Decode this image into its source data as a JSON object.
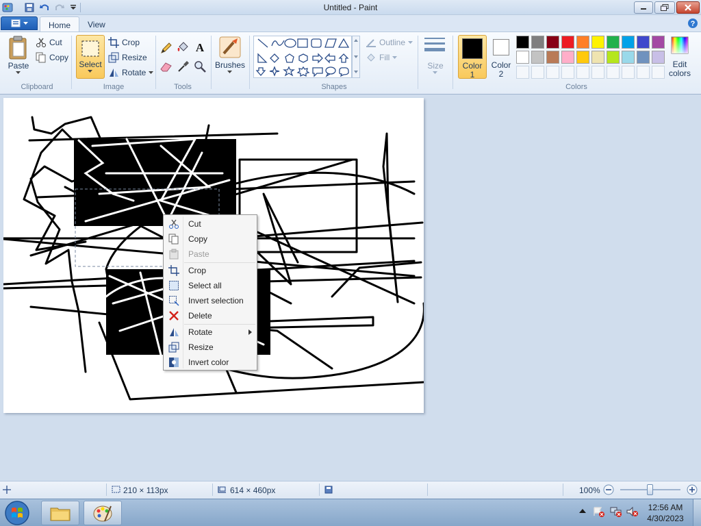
{
  "window": {
    "title": "Untitled - Paint"
  },
  "tabs": {
    "home": "Home",
    "view": "View"
  },
  "clipboard": {
    "paste": "Paste",
    "cut": "Cut",
    "copy": "Copy",
    "group": "Clipboard"
  },
  "image": {
    "select": "Select",
    "crop": "Crop",
    "resize": "Resize",
    "rotate": "Rotate",
    "group": "Image"
  },
  "tools": {
    "group": "Tools"
  },
  "brushes": {
    "label": "Brushes"
  },
  "shapes": {
    "group": "Shapes",
    "outline": "Outline",
    "fill": "Fill"
  },
  "size": {
    "label": "Size"
  },
  "colors": {
    "color1_line1": "Color",
    "color1_line2": "1",
    "color2_line1": "Color",
    "color2_line2": "2",
    "edit_line1": "Edit",
    "edit_line2": "colors",
    "group": "Colors",
    "color1_value": "#000000",
    "color2_value": "#ffffff",
    "palette_row1": [
      "#000000",
      "#7f7f7f",
      "#880015",
      "#ed1c24",
      "#ff7f27",
      "#fff200",
      "#22b14c",
      "#00a2e8",
      "#3f48cc",
      "#a349a4"
    ],
    "palette_row2": [
      "#ffffff",
      "#c3c3c3",
      "#b97a57",
      "#ffaec9",
      "#ffc90e",
      "#efe4b0",
      "#b5e61d",
      "#99d9ea",
      "#7092be",
      "#c8bfe7"
    ]
  },
  "context_menu": {
    "items": [
      {
        "label": "Cut",
        "icon": "scissors-icon",
        "enabled": true
      },
      {
        "label": "Copy",
        "icon": "copy-icon",
        "enabled": true
      },
      {
        "label": "Paste",
        "icon": "paste-icon",
        "enabled": false
      },
      {
        "label": "Crop",
        "icon": "crop-icon",
        "enabled": true
      },
      {
        "label": "Select all",
        "icon": "select-all-icon",
        "enabled": true
      },
      {
        "label": "Invert selection",
        "icon": "invert-selection-icon",
        "enabled": true
      },
      {
        "label": "Delete",
        "icon": "delete-icon",
        "enabled": true
      },
      {
        "label": "Rotate",
        "icon": "rotate-icon",
        "enabled": true,
        "submenu": true
      },
      {
        "label": "Resize",
        "icon": "resize-icon",
        "enabled": true
      },
      {
        "label": "Invert color",
        "icon": "invert-color-icon",
        "enabled": true
      }
    ]
  },
  "status": {
    "selection_size": "210 × 113px",
    "image_size": "614 × 460px",
    "zoom": "100%"
  },
  "taskbar": {
    "time": "12:56 AM",
    "date": "4/30/2023"
  }
}
